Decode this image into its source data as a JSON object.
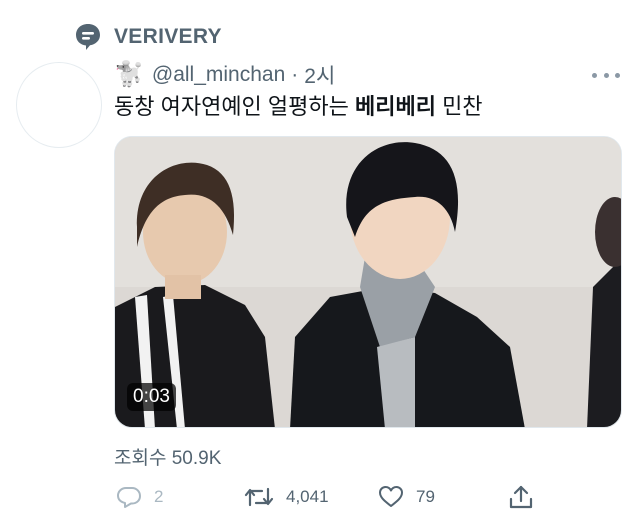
{
  "topic": {
    "label": "VERIVERY",
    "icon": "topic-bubble-icon"
  },
  "tweet": {
    "author_emoji": "🐩",
    "handle": "@all_minchan",
    "separator": "·",
    "time": "2시",
    "text_before": "동창 여자연예인 얼평하는 ",
    "text_bold": "베리베리",
    "text_after": " 민찬",
    "media": {
      "duration": "0:03"
    },
    "views": "조회수 50.9K"
  },
  "actions": {
    "reply_count": "2",
    "retweet_count": "4,041",
    "like_count": "79"
  },
  "colors": {
    "muted": "#536471",
    "disabled": "#aab8c2",
    "text": "#0f1419"
  }
}
